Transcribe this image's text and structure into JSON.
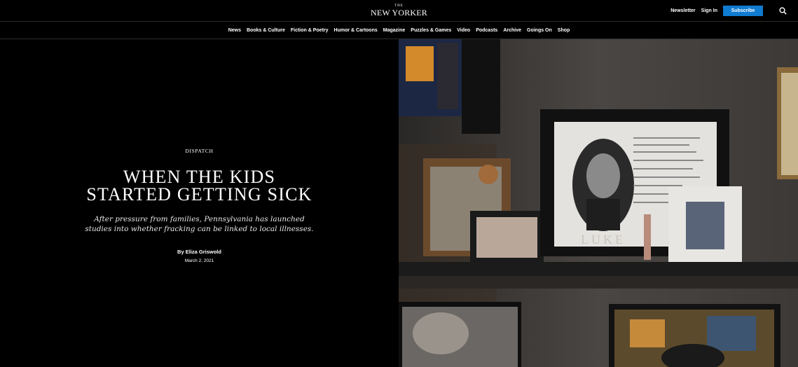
{
  "header": {
    "logo_small": "THE",
    "logo_main": "NEW YORKER",
    "newsletter_label": "Newsletter",
    "signin_label": "Sign In",
    "subscribe_label": "Subscribe",
    "search_icon": "search-icon",
    "subscribe_color": "#0f7bd1"
  },
  "nav": {
    "items": [
      {
        "label": "News"
      },
      {
        "label": "Books & Culture"
      },
      {
        "label": "Fiction & Poetry"
      },
      {
        "label": "Humor & Cartoons"
      },
      {
        "label": "Magazine"
      },
      {
        "label": "Puzzles & Games"
      },
      {
        "label": "Video"
      },
      {
        "label": "Podcasts"
      },
      {
        "label": "Archive"
      },
      {
        "label": "Goings On"
      },
      {
        "label": "Shop"
      }
    ]
  },
  "article": {
    "rubric": "DISPATCH",
    "headline_line1": "WHEN THE KIDS",
    "headline_line2": "STARTED GETTING SICK",
    "dek_line1": "After pressure from families, Pennsylvania has launched",
    "dek_line2": "studies into whether fracking can be linked to local illnesses.",
    "byline": "By Eliza Griswold",
    "date": "March 2, 2021"
  },
  "photo": {
    "nameplate": "LUKE"
  }
}
